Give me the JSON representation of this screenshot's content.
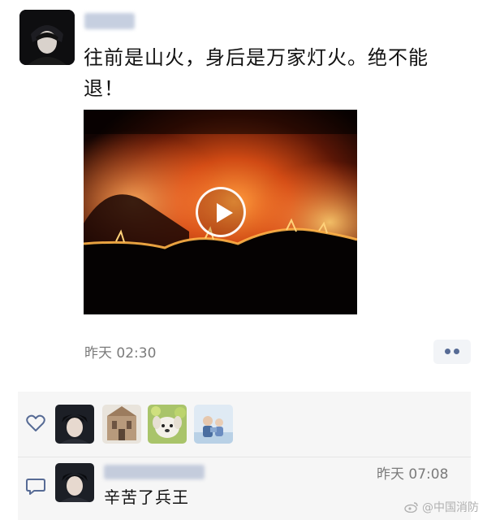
{
  "post": {
    "text": "往前是山火，身后是万家灯火。绝不能退！",
    "timestamp": "昨天 02:30",
    "video": {
      "play_icon": "play-icon"
    }
  },
  "likes": {
    "icon": "heart-outline-icon",
    "count_shown": 4
  },
  "comment": {
    "icon": "comment-bubble-icon",
    "timestamp": "昨天 07:08",
    "text": "辛苦了兵王"
  },
  "watermark": {
    "text": "@中国消防",
    "icon": "weibo-icon"
  },
  "colors": {
    "link_blue": "#576b95",
    "timestamp_gray": "#7b7b7b",
    "panel_bg": "#f6f6f6"
  }
}
